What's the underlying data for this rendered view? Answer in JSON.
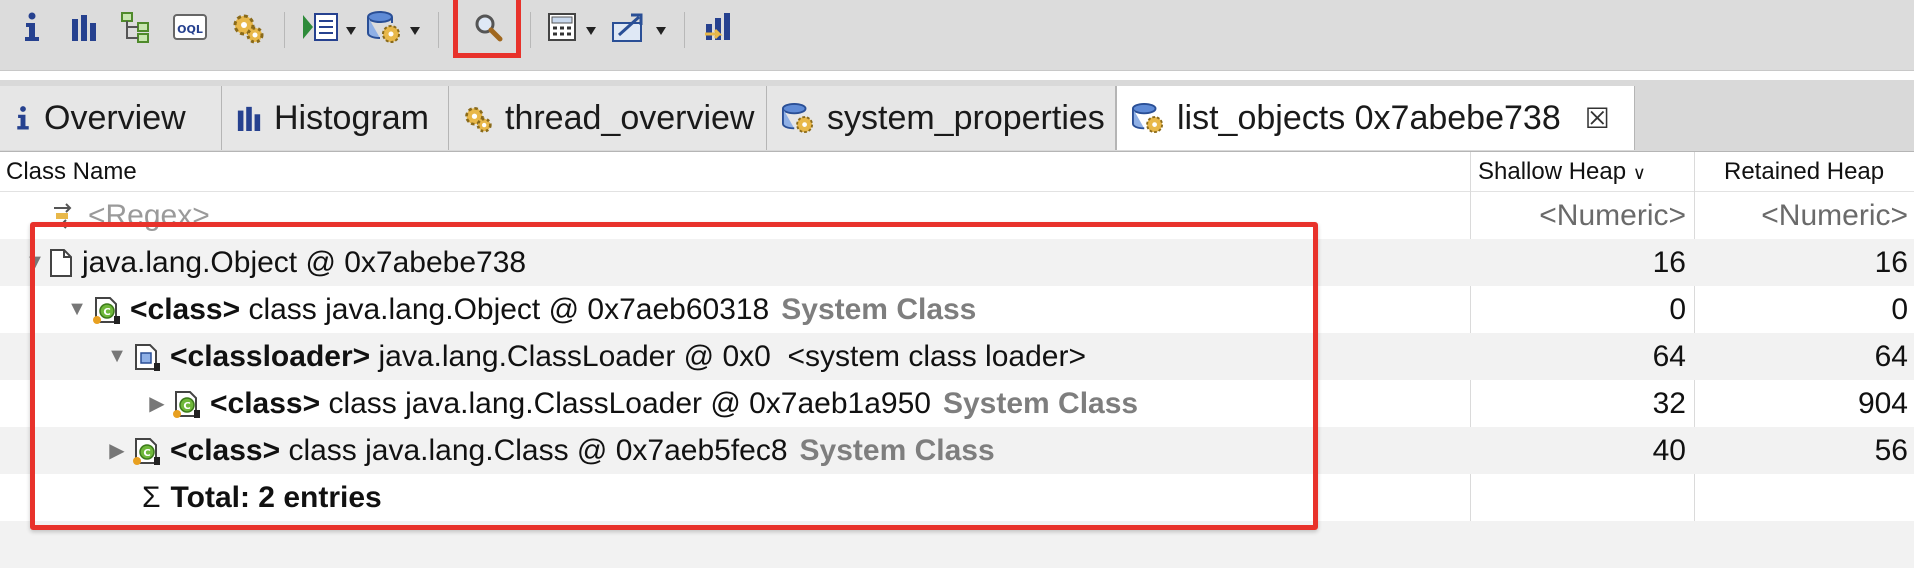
{
  "toolbar": {
    "items": [
      {
        "icon": "info-icon"
      },
      {
        "icon": "histogram-icon"
      },
      {
        "icon": "dominator-tree-icon"
      },
      {
        "icon": "oql-icon",
        "label": "OQL"
      },
      {
        "icon": "thread-overview-icon"
      },
      {
        "icon": "run-report-icon",
        "has_dropdown": true
      },
      {
        "icon": "query-browser-icon",
        "has_dropdown": true
      },
      {
        "icon": "search-icon",
        "highlighted": true
      },
      {
        "icon": "calculator-icon",
        "has_dropdown": true
      },
      {
        "icon": "export-icon",
        "has_dropdown": true
      },
      {
        "icon": "heap-dump-icon"
      }
    ]
  },
  "tabs": [
    {
      "label": "Overview",
      "icon": "info-icon"
    },
    {
      "label": "Histogram",
      "icon": "histogram-icon"
    },
    {
      "label": "thread_overview",
      "icon": "thread-overview-icon"
    },
    {
      "label": "system_properties",
      "icon": "query-browser-icon"
    },
    {
      "label": "list_objects 0x7abebe738",
      "icon": "query-browser-icon",
      "active": true,
      "close": "☒"
    }
  ],
  "table": {
    "columns": {
      "class_name": "Class Name",
      "shallow_heap": "Shallow Heap",
      "shallow_sort": "∨",
      "retained_heap": "Retained Heap"
    },
    "filter": {
      "class_name": "<Regex>",
      "shallow_heap": "<Numeric>",
      "retained_heap": "<Numeric>"
    },
    "rows": [
      {
        "tri": "▼",
        "icon": "object-icon",
        "bold": "",
        "text": "java.lang.Object @ 0x7abebe738",
        "suffix": "",
        "shallow": "16",
        "retained": "16"
      },
      {
        "tri": "▼",
        "icon": "class-icon",
        "bold": "<class>",
        "text": " class java.lang.Object @ 0x7aeb60318",
        "suffix": "System Class",
        "shallow": "0",
        "retained": "0"
      },
      {
        "tri": "▼",
        "icon": "classloader-icon",
        "bold": "<classloader>",
        "text": " java.lang.ClassLoader @ 0x0  <system class loader>",
        "suffix": "",
        "shallow": "64",
        "retained": "64"
      },
      {
        "tri": "▶",
        "icon": "class-icon",
        "bold": "<class>",
        "text": " class java.lang.ClassLoader @ 0x7aeb1a950",
        "suffix": "System Class",
        "shallow": "32",
        "retained": "904"
      },
      {
        "tri": "▶",
        "icon": "class-icon",
        "bold": "<class>",
        "text": " class java.lang.Class @ 0x7aeb5fec8",
        "suffix": "System Class",
        "shallow": "40",
        "retained": "56"
      }
    ],
    "total": {
      "symbol": "Σ",
      "label": "Total: 2 entries"
    }
  },
  "colors": {
    "highlight": "#e8322b",
    "suffix_gray": "#7e7e7e"
  }
}
